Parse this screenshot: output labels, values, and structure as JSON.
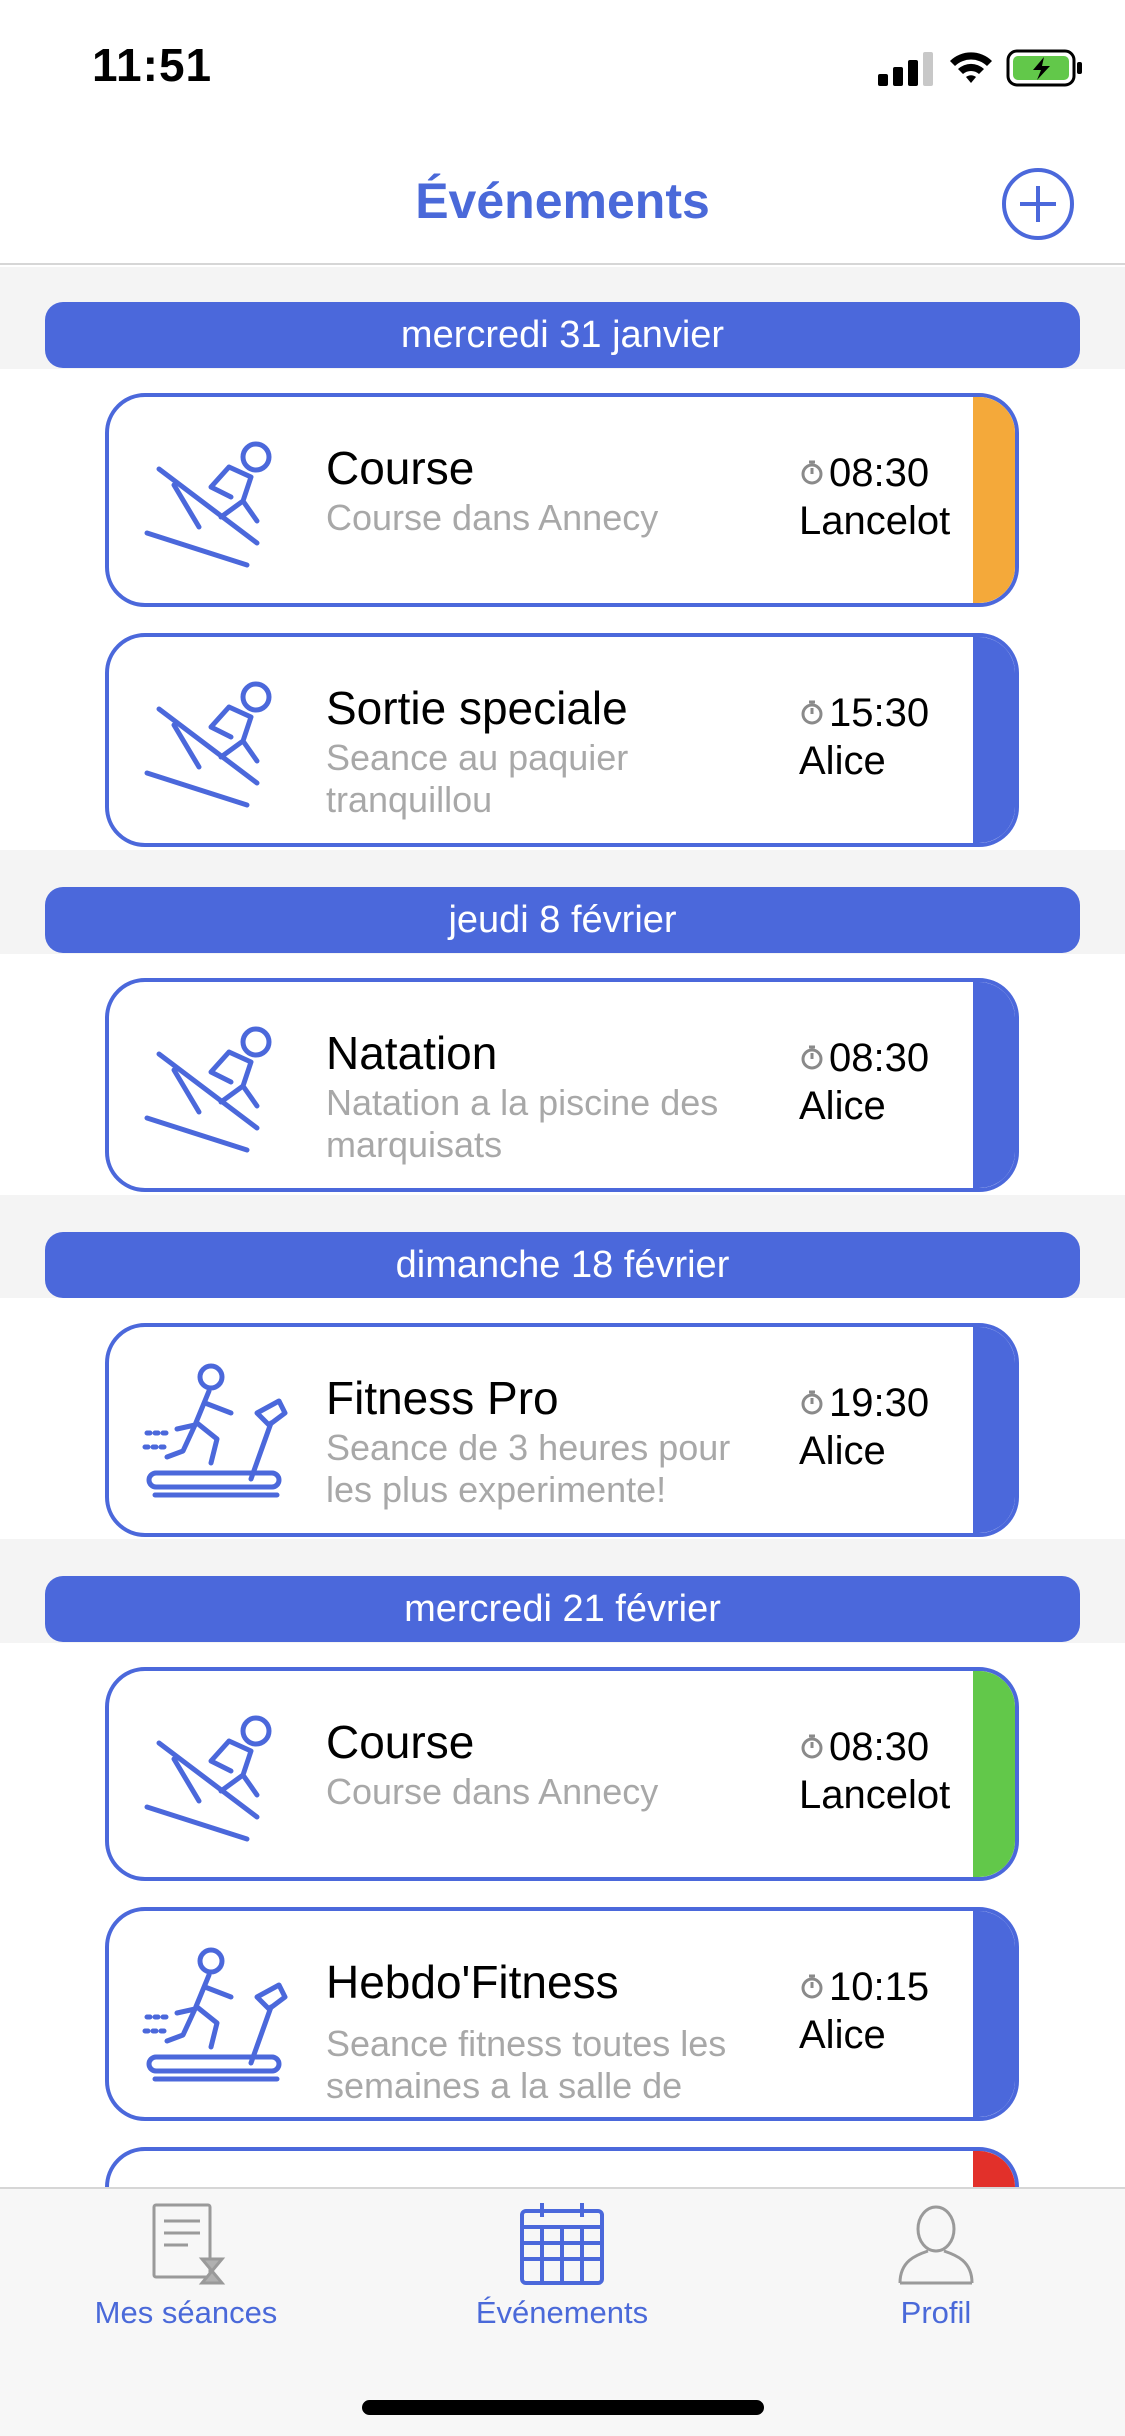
{
  "status_bar": {
    "time": "11:51"
  },
  "nav": {
    "title": "Événements"
  },
  "colors": {
    "accent": "#4b68db",
    "orange": "#f4a93a",
    "green": "#62c84a",
    "red": "#e2302a"
  },
  "sections": [
    {
      "date": "mercredi 31 janvier",
      "events": [
        {
          "title": "Course",
          "description": "Course dans Annecy",
          "time": "08:30",
          "person": "Lancelot",
          "icon": "skier-icon",
          "status_color": "#f4a93a"
        },
        {
          "title": "Sortie speciale",
          "description": "Seance au paquier tranquillou",
          "time": "15:30",
          "person": "Alice",
          "icon": "skier-icon",
          "status_color": "#4b68db"
        }
      ]
    },
    {
      "date": "jeudi 8 février",
      "events": [
        {
          "title": "Natation",
          "description": "Natation a la piscine des marquisats",
          "time": "08:30",
          "person": "Alice",
          "icon": "skier-icon",
          "status_color": "#4b68db"
        }
      ]
    },
    {
      "date": "dimanche 18 février",
      "events": [
        {
          "title": "Fitness Pro",
          "description": "Seance de 3 heures pour les plus experimente!",
          "time": "19:30",
          "person": "Alice",
          "icon": "treadmill-icon",
          "status_color": "#4b68db"
        }
      ]
    },
    {
      "date": "mercredi 21 février",
      "events": [
        {
          "title": "Course",
          "description": "Course dans Annecy",
          "time": "08:30",
          "person": "Lancelot",
          "icon": "skier-icon",
          "status_color": "#62c84a"
        },
        {
          "title": "Hebdo'Fitness",
          "description": "Seance fitness toutes les semaines a la salle de",
          "time": "10:15",
          "person": "Alice",
          "icon": "treadmill-icon",
          "status_color": "#4b68db"
        }
      ]
    }
  ],
  "tabs": [
    {
      "label": "Mes séances",
      "icon": "sessions-icon"
    },
    {
      "label": "Événements",
      "icon": "calendar-icon",
      "selected": true
    },
    {
      "label": "Profil",
      "icon": "profile-icon"
    }
  ]
}
